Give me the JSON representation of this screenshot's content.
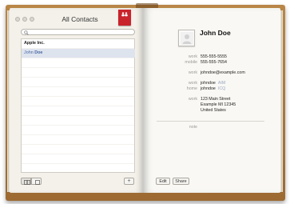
{
  "window": {
    "title": "All Contacts"
  },
  "bookmark": {
    "icon": "person-bookmark-icon",
    "color": "#c9232b"
  },
  "search": {
    "icon": "magnifier-icon",
    "placeholder": "",
    "value": ""
  },
  "contacts_list": {
    "group_label": "Apple Inc.",
    "selected_contact": {
      "first": "John",
      "last": "Doe"
    }
  },
  "view_toggle": {
    "icons": [
      "two-page-view-icon",
      "single-page-view-icon"
    ]
  },
  "add_button_label": "+",
  "card": {
    "name": "John Doe",
    "avatar_icon": "person-placeholder-icon",
    "fields": {
      "phone_work_label": "work",
      "phone_work": "555-555-5555",
      "phone_mobile_label": "mobile",
      "phone_mobile": "555-555-7654",
      "email_work_label": "work",
      "email_work": "johndoe@example.com",
      "im_work_label": "work",
      "im_work_handle": "johndoe",
      "im_work_service": "AIM",
      "im_home_label": "home",
      "im_home_handle": "johndoe",
      "im_home_service": "ICQ",
      "address_label": "work",
      "address_line1": "123 Main Street",
      "address_line2": "Example MI 12345",
      "address_line3": "United States",
      "note_label": "note"
    }
  },
  "actions": {
    "edit_label": "Edit",
    "share_label": "Share"
  },
  "colors": {
    "selection_bg": "#dde4ee",
    "selection_text": "#4b66a4",
    "cover": "#a9763a"
  }
}
